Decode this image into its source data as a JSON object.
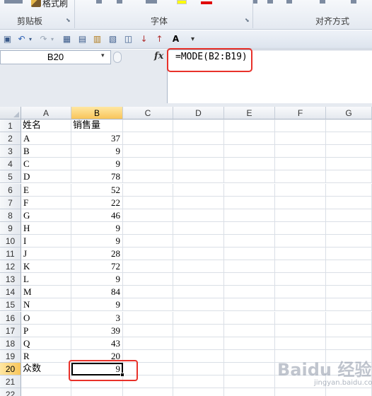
{
  "ribbon": {
    "format_painter_label": "格式刷",
    "groups": [
      {
        "name": "clipboard",
        "label": "剪贴板"
      },
      {
        "name": "font",
        "label": "字体"
      },
      {
        "name": "alignment",
        "label": "对齐方式"
      }
    ],
    "colors": {
      "highlight": "#ffff00",
      "font_color": "#e00000"
    }
  },
  "qat": {
    "icons": [
      "save-icon",
      "undo-icon",
      "redo-icon",
      "table-icon",
      "form-icon",
      "paste-special-icon",
      "print-icon",
      "print-preview-icon",
      "sort-ascending-icon",
      "sort-descending-icon",
      "increase-font-icon",
      "customize-dropdown-icon"
    ]
  },
  "formula_bar": {
    "name_box": "B20",
    "fx_label": "fx",
    "formula": "=MODE(B2:B19)"
  },
  "sheet": {
    "columns": [
      "A",
      "B",
      "C",
      "D",
      "E",
      "F",
      "G"
    ],
    "selected_column": "B",
    "selected_row": "20",
    "active_cell": "B20",
    "rows": [
      {
        "n": "1",
        "a": "姓名",
        "b": "销售量"
      },
      {
        "n": "2",
        "a": "A",
        "b": "37"
      },
      {
        "n": "3",
        "a": "B",
        "b": "9"
      },
      {
        "n": "4",
        "a": "C",
        "b": "9"
      },
      {
        "n": "5",
        "a": "D",
        "b": "78"
      },
      {
        "n": "6",
        "a": "E",
        "b": "52"
      },
      {
        "n": "7",
        "a": "F",
        "b": "22"
      },
      {
        "n": "8",
        "a": "G",
        "b": "46"
      },
      {
        "n": "9",
        "a": "H",
        "b": "9"
      },
      {
        "n": "10",
        "a": "I",
        "b": "9"
      },
      {
        "n": "11",
        "a": "J",
        "b": "28"
      },
      {
        "n": "12",
        "a": "K",
        "b": "72"
      },
      {
        "n": "13",
        "a": "L",
        "b": "9"
      },
      {
        "n": "14",
        "a": "M",
        "b": "84"
      },
      {
        "n": "15",
        "a": "N",
        "b": "9"
      },
      {
        "n": "16",
        "a": "O",
        "b": "3"
      },
      {
        "n": "17",
        "a": "P",
        "b": "39"
      },
      {
        "n": "18",
        "a": "Q",
        "b": "43"
      },
      {
        "n": "19",
        "a": "R",
        "b": "20"
      },
      {
        "n": "20",
        "a": "众数",
        "b": "9"
      },
      {
        "n": "21",
        "a": "",
        "b": ""
      },
      {
        "n": "22",
        "a": "",
        "b": ""
      }
    ]
  },
  "watermark": {
    "text": "Baidu 经验",
    "sub": "jingyan.baidu.com"
  }
}
